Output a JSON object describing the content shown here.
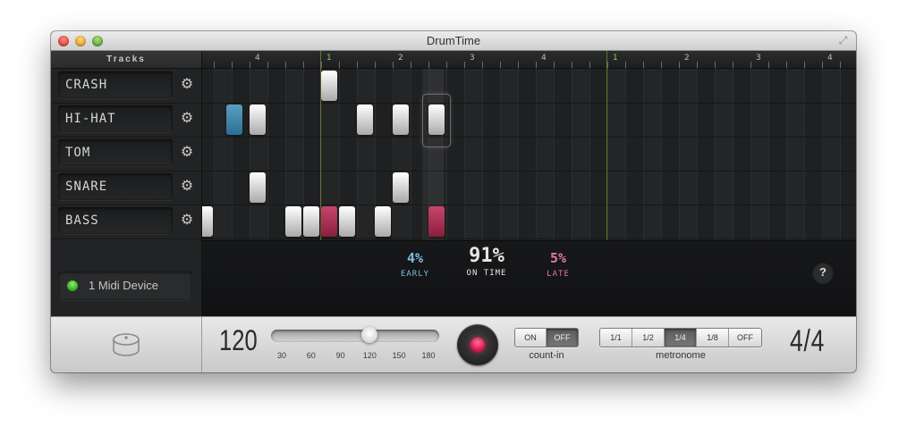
{
  "window": {
    "title": "DrumTime"
  },
  "tracks": {
    "header": "Tracks",
    "items": [
      {
        "name": "CRASH"
      },
      {
        "name": "HI-HAT"
      },
      {
        "name": "TOM"
      },
      {
        "name": "SNARE"
      },
      {
        "name": "BASS"
      }
    ]
  },
  "midi": {
    "label": "1 Midi Device",
    "status_color": "#3cc42a"
  },
  "ruler": {
    "labels": [
      "4",
      "1",
      "2",
      "3",
      "4",
      "1",
      "2",
      "3",
      "4"
    ]
  },
  "stats": {
    "early": {
      "value": "4%",
      "label": "EARLY",
      "color": "#7fbde0"
    },
    "on_time": {
      "value": "91%",
      "label": "ON TIME",
      "color": "#e6e6e6"
    },
    "late": {
      "value": "5%",
      "label": "LATE",
      "color": "#e07a9d"
    }
  },
  "help": {
    "label": "?"
  },
  "tempo": {
    "value": "120",
    "slider_level": 120,
    "slider_range": [
      30,
      180
    ],
    "scale": [
      "30",
      "60",
      "90",
      "120",
      "150",
      "180"
    ]
  },
  "count_in": {
    "label": "count-in",
    "options": [
      "ON",
      "OFF"
    ],
    "selected": "OFF"
  },
  "metronome": {
    "label": "metronome",
    "options": [
      "1/1",
      "1/2",
      "1/4",
      "1/8",
      "OFF"
    ],
    "selected": "1/4"
  },
  "time_signature": "4/4",
  "colors": {
    "early_note": "#3f87ad",
    "late_note": "#b32f57",
    "bar_line": "#62742e",
    "record": "#e0134f"
  }
}
